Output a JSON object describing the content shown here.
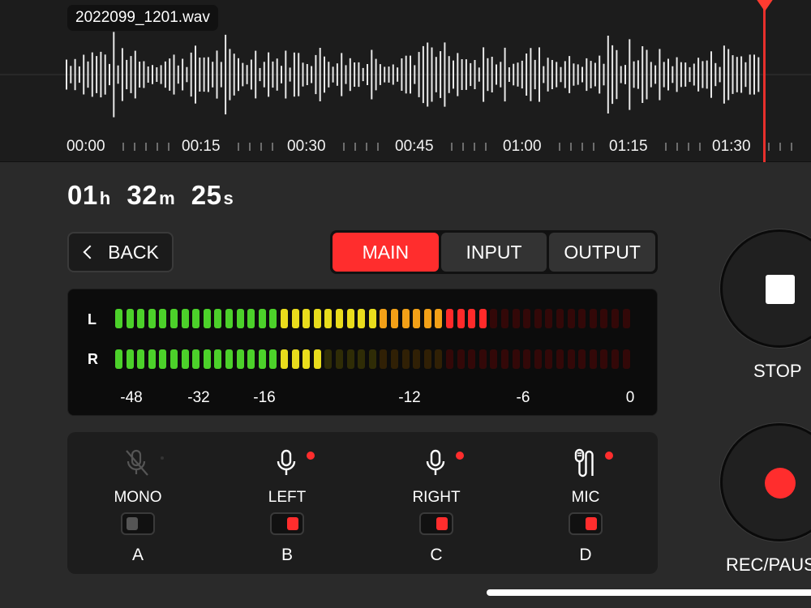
{
  "file": {
    "name": "2022099_1201.wav"
  },
  "timeline": {
    "labels": [
      "00:00",
      "00:15",
      "00:30",
      "00:45",
      "01:00",
      "01:15",
      "01:30"
    ]
  },
  "elapsed": {
    "h": "01",
    "h_unit": "h",
    "m": "32",
    "m_unit": "m",
    "s": "25",
    "s_unit": "s"
  },
  "nav": {
    "back_label": "BACK"
  },
  "tabs": [
    {
      "label": "MAIN",
      "active": true
    },
    {
      "label": "INPUT",
      "active": false
    },
    {
      "label": "OUTPUT",
      "active": false
    }
  ],
  "meter": {
    "channels": [
      {
        "label": "L",
        "level_segments": 34
      },
      {
        "label": "R",
        "level_segments": 19
      }
    ],
    "total_segments": 47,
    "scale": [
      "-48",
      "-32",
      "-16",
      "-12",
      "-6",
      "0"
    ],
    "colors": {
      "green": "#4cd12a",
      "yellow": "#e9dc1c",
      "orange": "#f2a017",
      "red": "#ff2a2a"
    }
  },
  "inputs": [
    {
      "name": "MONO",
      "letter": "A",
      "icon": "mic-off-icon",
      "enabled": false
    },
    {
      "name": "LEFT",
      "letter": "B",
      "icon": "mic-icon",
      "enabled": true
    },
    {
      "name": "RIGHT",
      "letter": "C",
      "icon": "mic-icon",
      "enabled": true
    },
    {
      "name": "MIC",
      "letter": "D",
      "icon": "lavalier-mic-icon",
      "enabled": true
    }
  ],
  "transport": {
    "stop_label": "STOP",
    "rec_label": "REC/PAUSE"
  },
  "colors": {
    "accent": "#ff2d2d",
    "playhead": "#e8302c"
  }
}
